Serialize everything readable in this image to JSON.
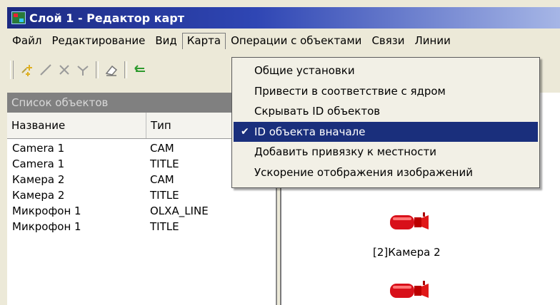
{
  "window": {
    "title": "Слой 1 - Редактор карт"
  },
  "menubar": [
    {
      "label": "Файл"
    },
    {
      "label": "Редактирование"
    },
    {
      "label": "Вид"
    },
    {
      "label": "Карта"
    },
    {
      "label": "Операции с объектами"
    },
    {
      "label": "Связи"
    },
    {
      "label": "Линии"
    }
  ],
  "map_menu": {
    "items": [
      {
        "label": "Общие установки",
        "checked": false
      },
      {
        "label": "Привести в соответствие с ядром",
        "checked": false
      },
      {
        "label": "Скрывать ID объектов",
        "checked": false
      },
      {
        "label": "ID объекта вначале",
        "checked": true
      },
      {
        "label": "Добавить привязку к местности",
        "checked": false
      },
      {
        "label": "Ускорение отображения изображений",
        "checked": false
      }
    ],
    "check_glyph": "✔"
  },
  "toolbar": {
    "icons": [
      "add-object-icon",
      "draw-line-icon",
      "delete-icon",
      "node-icon",
      "eraser-icon",
      "arrow-icon"
    ]
  },
  "objects_panel": {
    "title": "Список объектов",
    "columns": {
      "name": "Название",
      "type": "Тип"
    },
    "rows": [
      {
        "name": "Camera 1",
        "type": "CAM"
      },
      {
        "name": "Camera 1",
        "type": "TITLE"
      },
      {
        "name": "Камера 2",
        "type": "CAM"
      },
      {
        "name": "Камера 2",
        "type": "TITLE"
      },
      {
        "name": "Микрофон 1",
        "type": "OLXA_LINE"
      },
      {
        "name": "Микрофон 1",
        "type": "TITLE"
      }
    ]
  },
  "map": {
    "label": "[2]Камера 2"
  },
  "colors": {
    "title_start": "#1c2a82",
    "title_end": "#a6b6e6",
    "selection": "#1a2f7c",
    "camera": "#d8101a"
  }
}
